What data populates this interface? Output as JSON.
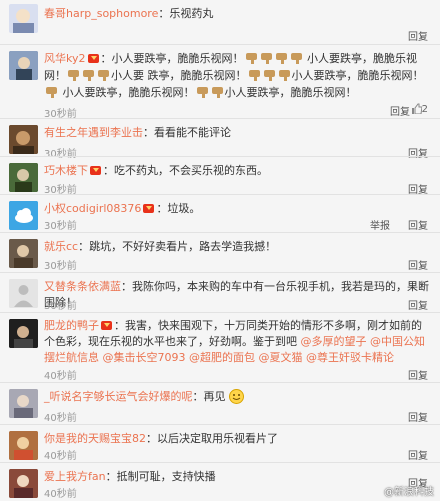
{
  "comments": [
    {
      "name": "春哥harp_sophomore",
      "text": "：乐视药丸",
      "time": "",
      "reply": "回复",
      "avatar_color": "#d9dff0"
    },
    {
      "name": "风华ky2",
      "text_parts": [
        "：小人要跌亭，脆脆乐视网！",
        "小人要跌亭，脆脆乐视网！",
        "小人要",
        "跌亭，脆脆乐视网！",
        "小人要跌亭，脆脆乐视网！",
        "小人要跌亭，",
        "脆脆乐视网！",
        "小人要跌亭，脆脆乐视网！"
      ],
      "time": "30秒前",
      "reply": "回复",
      "likes": "2",
      "avatar_color": "#6a7fa0"
    },
    {
      "name": "有生之年遇到李业击",
      "text": "：看看能不能评论",
      "time": "30秒前",
      "reply": "回复",
      "avatar_color": "#7b5a3c"
    },
    {
      "name": "巧木楼下",
      "text": "：吃不药丸，不会买乐视的东西。",
      "time": "30秒前",
      "reply": "回复",
      "avatar_color": "#3c5a2a"
    },
    {
      "name": "小权codigirl08376",
      "text": "：垃圾。",
      "time": "30秒前",
      "report": "举报",
      "reply": "回复",
      "avatar_color": "#3da6e4"
    },
    {
      "name": "就乐cc",
      "text": "：跳坑，不好好卖看片，路去学造我撼！",
      "time": "30秒前",
      "reply": "回复",
      "avatar_color": "#5a4a3a"
    },
    {
      "name": "又替条条依满蓝",
      "text": "：我陈你吗，本来购的车中有一台乐视手机，我若是玛的，果断围除！",
      "time": "30秒前",
      "reply": "回复",
      "avatar_color": "#d8d8d8"
    },
    {
      "name": "肥龙的鸭子",
      "text_parts": [
        "：我害，快来围观下，十万同类开始的情形不多啊，刚才如前的个色彩，现在乐视的",
        "水平也来了，好劲啊。鉴于到吧",
        "@多厚的望子",
        "@中国公知摆烂航信息",
        "@集击长空7093",
        "@超肥的面包",
        "@夏文猫",
        "@尊王奸驳卡精论"
      ],
      "time": "40秒前",
      "reply": "回复",
      "avatar_color": "#2a2a2a"
    },
    {
      "name": "_听说名字够长运气会好爆的呢",
      "text": "：再见",
      "time": "40秒前",
      "reply": "回复",
      "avatar_color": "#b0b0b8"
    },
    {
      "name": "你是我的天赐宝宝82",
      "text": "：以后决定取用乐视看片了",
      "time": "40秒前",
      "reply": "回复",
      "avatar_color": "#c07a3a"
    },
    {
      "name": "爱上我方fan",
      "text": "：抵制可耻，支持快播",
      "time": "40秒前",
      "reply": "回复",
      "avatar_color": "#9a5a4a"
    }
  ],
  "watermark": "@新浪科技",
  "colors": {
    "name": "#eb7350",
    "vip": "#e8311a",
    "thumb": "#c89a5a"
  }
}
